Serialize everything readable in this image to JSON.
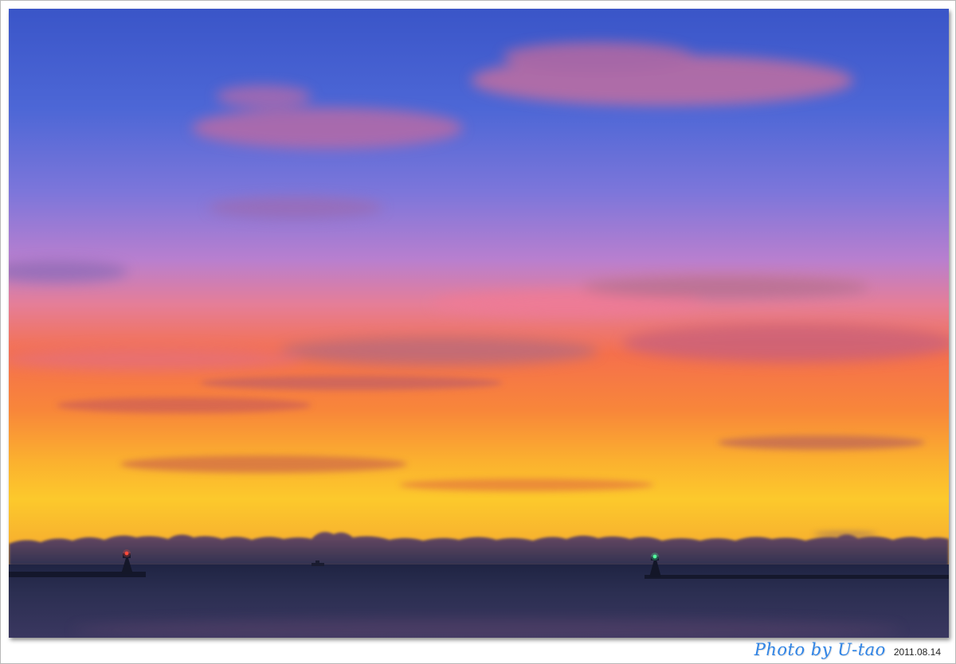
{
  "photo": {
    "subject": "Sunset over the sea with two harbor lighthouses",
    "colors": {
      "sky_top": "#3f5fd4",
      "sky_mid": "#8a78d8",
      "sky_pink": "#e47a92",
      "sky_orange": "#f4772e",
      "horizon_yellow": "#fbc52a",
      "cloud_band": "#3d3a5a",
      "sea": "#262a48",
      "beacon_red": "#ff4a3a",
      "beacon_green": "#52ff9e"
    }
  },
  "caption": {
    "signature": "Photo by U-tao",
    "date": "2011.08.14"
  }
}
